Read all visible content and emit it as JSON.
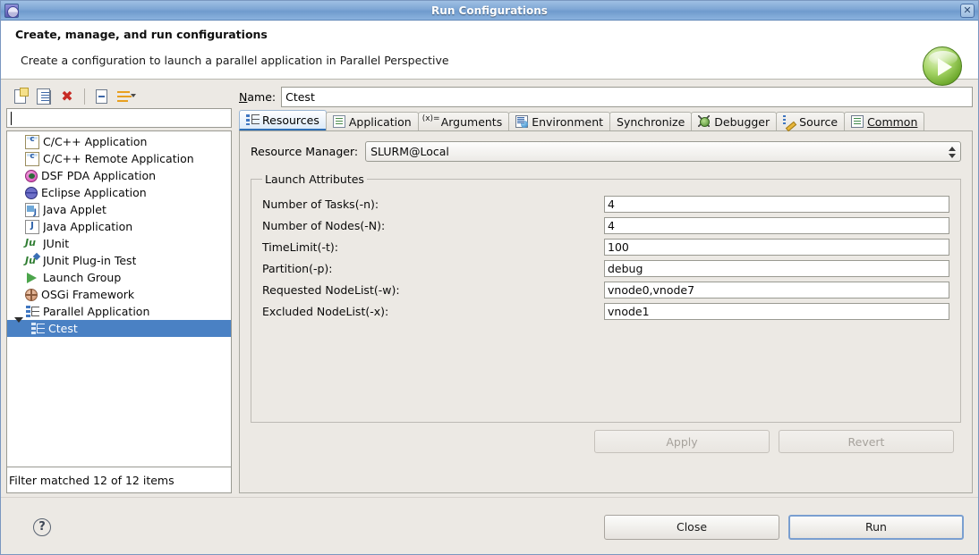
{
  "window": {
    "title": "Run Configurations",
    "app_icon": "eclipse-icon",
    "close_label": "✕"
  },
  "banner": {
    "title": "Create, manage, and run configurations",
    "subtitle": "Create a configuration to launch a parallel application in Parallel Perspective",
    "badge_icon": "run-play-icon"
  },
  "left_panel": {
    "toolbar": [
      {
        "name": "new-launch-configuration-button",
        "icon": "new-document-icon"
      },
      {
        "name": "duplicate-launch-configuration-button",
        "icon": "duplicate-document-icon"
      },
      {
        "name": "delete-launch-configuration-button",
        "icon": "delete-red-x-icon"
      },
      {
        "name": "collapse-all-button",
        "icon": "collapse-all-icon"
      },
      {
        "name": "filter-launch-configurations-button",
        "icon": "filter-icon"
      }
    ],
    "filter": {
      "value": "",
      "placeholder": ""
    },
    "tree": [
      {
        "label": "C/C++ Application",
        "icon": "cpp-application-icon",
        "indent": 0,
        "selected": false,
        "twisty": "none"
      },
      {
        "label": "C/C++ Remote Application",
        "icon": "cpp-remote-application-icon",
        "indent": 0,
        "selected": false,
        "twisty": "none"
      },
      {
        "label": "DSF PDA Application",
        "icon": "dsf-pda-icon",
        "indent": 0,
        "selected": false,
        "twisty": "none"
      },
      {
        "label": "Eclipse Application",
        "icon": "eclipse-application-icon",
        "indent": 0,
        "selected": false,
        "twisty": "none"
      },
      {
        "label": "Java Applet",
        "icon": "java-applet-icon",
        "indent": 0,
        "selected": false,
        "twisty": "none"
      },
      {
        "label": "Java Application",
        "icon": "java-application-icon",
        "indent": 0,
        "selected": false,
        "twisty": "none"
      },
      {
        "label": "JUnit",
        "icon": "junit-icon",
        "indent": 0,
        "selected": false,
        "twisty": "none"
      },
      {
        "label": "JUnit Plug-in Test",
        "icon": "junit-plugin-test-icon",
        "indent": 0,
        "selected": false,
        "twisty": "none"
      },
      {
        "label": "Launch Group",
        "icon": "launch-group-icon",
        "indent": 0,
        "selected": false,
        "twisty": "none"
      },
      {
        "label": "OSGi Framework",
        "icon": "osgi-framework-icon",
        "indent": 0,
        "selected": false,
        "twisty": "none"
      },
      {
        "label": "Parallel Application",
        "icon": "parallel-application-icon",
        "indent": 0,
        "selected": false,
        "twisty": "expanded"
      },
      {
        "label": "Ctest",
        "icon": "parallel-application-icon",
        "indent": 1,
        "selected": true,
        "twisty": "none"
      }
    ],
    "status": "Filter matched 12 of 12 items"
  },
  "right_panel": {
    "name_label": "Name:",
    "name_value": "Ctest",
    "tabs": [
      {
        "label": "Resources",
        "icon": "resources-icon",
        "active": true
      },
      {
        "label": "Application",
        "icon": "application-doc-icon",
        "active": false
      },
      {
        "label": "Arguments",
        "icon": "arguments-icon",
        "active": false
      },
      {
        "label": "Environment",
        "icon": "environment-icon",
        "active": false
      },
      {
        "label": "Synchronize",
        "icon": "",
        "active": false
      },
      {
        "label": "Debugger",
        "icon": "debugger-bug-icon",
        "active": false
      },
      {
        "label": "Source",
        "icon": "source-icon",
        "active": false
      },
      {
        "label": "Common",
        "icon": "common-icon",
        "active": false
      }
    ],
    "resource_manager": {
      "label": "Resource Manager:",
      "selected": "SLURM@Local"
    },
    "launch_attributes": {
      "legend": "Launch Attributes",
      "rows": [
        {
          "label": "Number of Tasks(-n):",
          "value": "4"
        },
        {
          "label": "Number of Nodes(-N):",
          "value": "4"
        },
        {
          "label": "TimeLimit(-t):",
          "value": "100"
        },
        {
          "label": "Partition(-p):",
          "value": "debug"
        },
        {
          "label": "Requested NodeList(-w):",
          "value": "vnode0,vnode7"
        },
        {
          "label": "Excluded NodeList(-x):",
          "value": "vnode1"
        }
      ]
    },
    "apply_label": "Apply",
    "revert_label": "Revert"
  },
  "footer": {
    "help_icon": "help-question-icon",
    "close_label": "Close",
    "run_label": "Run"
  },
  "colors": {
    "titlebar": "#7ea6d4",
    "selection": "#4a81c4",
    "dialog_bg": "#ece9e4",
    "active_tab_underline": "#2e6fb7",
    "run_green": "#6faa2e",
    "delete_red": "#c72a24",
    "focus_border": "#7a9fd0"
  }
}
